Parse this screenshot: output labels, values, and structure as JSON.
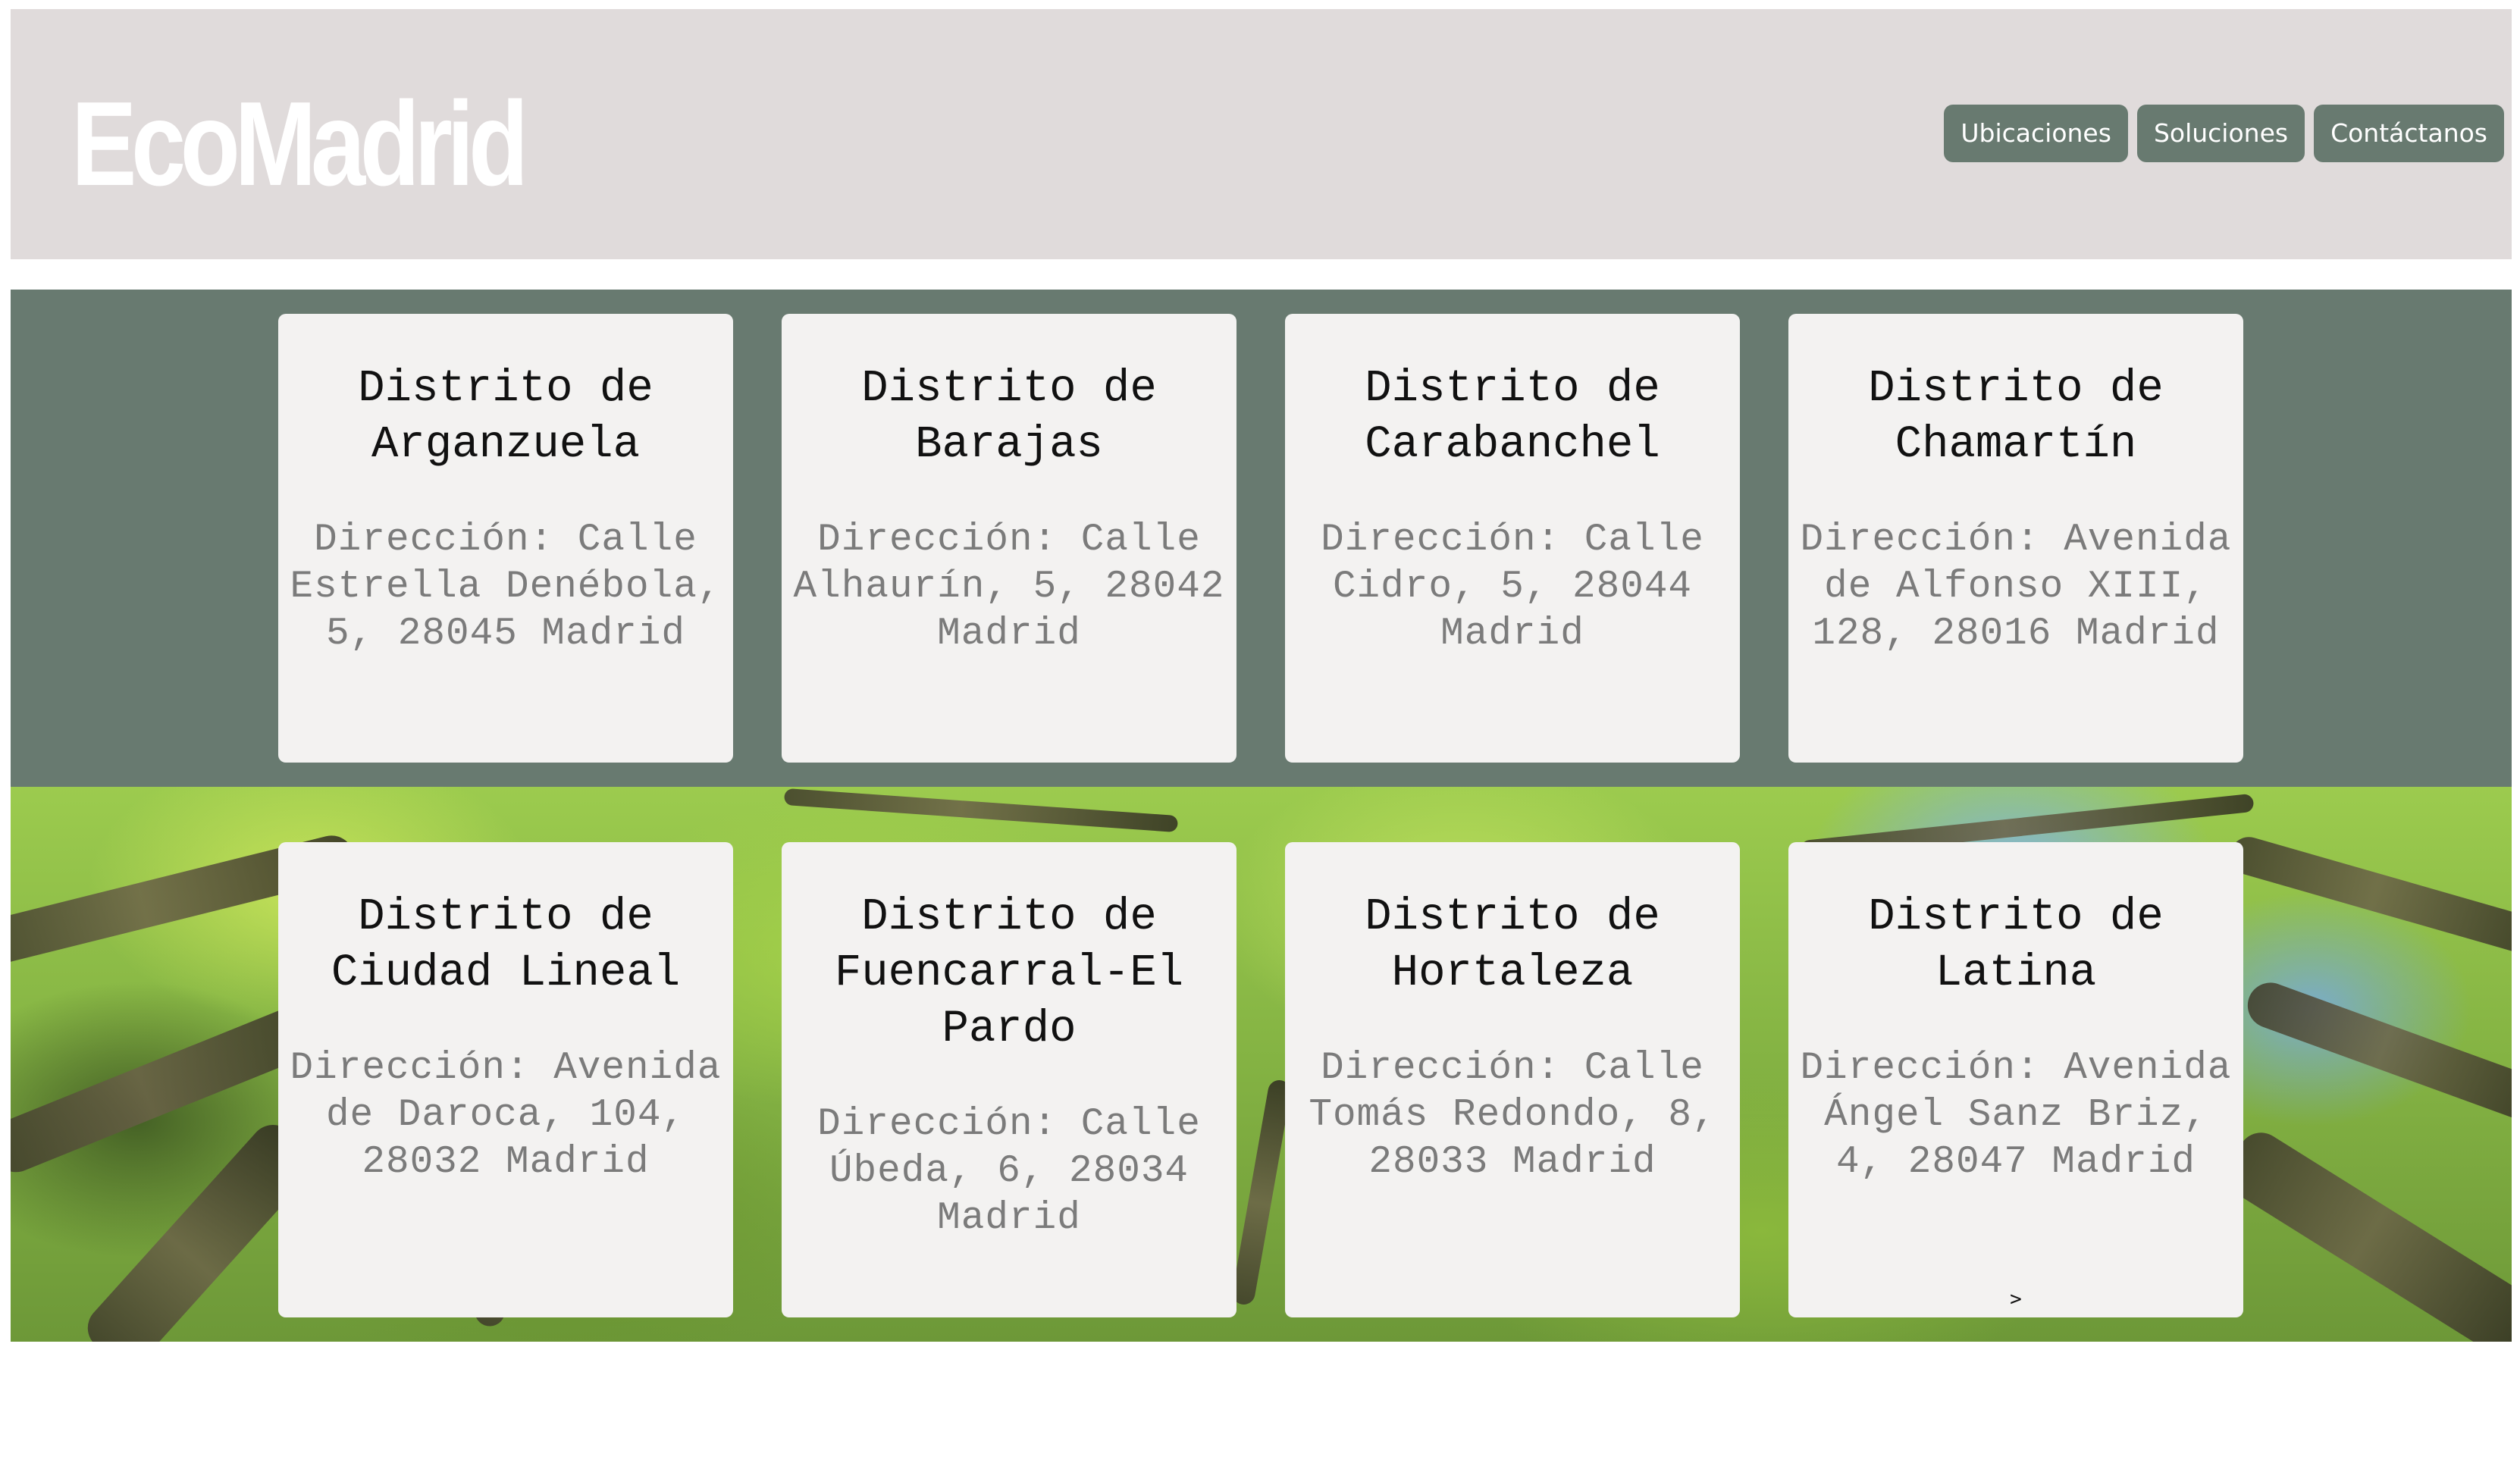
{
  "header": {
    "logo": "EcoMadrid",
    "nav": [
      {
        "label": "Ubicaciones"
      },
      {
        "label": "Soluciones"
      },
      {
        "label": "Contáctanos"
      }
    ]
  },
  "districts": [
    {
      "title": "Distrito de Arganzuela",
      "address": "Dirección: Calle Estrella Denébola, 5, 28045 Madrid"
    },
    {
      "title": "Distrito de Barajas",
      "address": "Dirección: Calle Alhaurín, 5, 28042 Madrid"
    },
    {
      "title": "Distrito de Carabanchel",
      "address": "Dirección: Calle Cidro, 5, 28044 Madrid"
    },
    {
      "title": "Distrito de Chamartín",
      "address": "Dirección: Avenida de Alfonso XIII, 128, 28016 Madrid"
    },
    {
      "title": "Distrito de Ciudad Lineal",
      "address": "Dirección: Avenida de Daroca, 104, 28032 Madrid"
    },
    {
      "title": "Distrito de Fuencarral-El Pardo",
      "address": "Dirección: Calle Úbeda, 6, 28034 Madrid"
    },
    {
      "title": "Distrito de Hortaleza",
      "address": "Dirección: Calle Tomás Redondo, 8, 28033 Madrid"
    },
    {
      "title": "Distrito de Latina",
      "address": "Dirección: Avenida Ángel Sanz Briz, 4, 28047 Madrid"
    }
  ],
  "latina_arrow": ">",
  "colors": {
    "header_bg": "#e0dbdb",
    "accent_green": "#687a70",
    "card_bg": "#f3f2f1",
    "address_gray": "#7b7b7b"
  }
}
